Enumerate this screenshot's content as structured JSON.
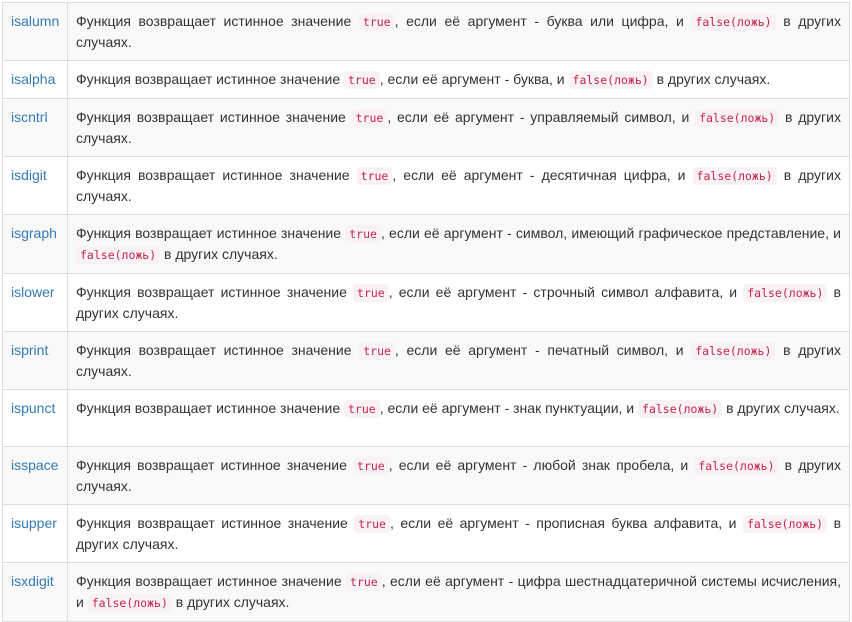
{
  "code": {
    "true_label": "true",
    "false_label": "false(ложь)"
  },
  "rows": [
    {
      "fn": "isalumn",
      "before": "Функция возвращает истинное значение ",
      "middle": ", если её аргумент - буква или цифра, и ",
      "after": " в других случаях."
    },
    {
      "fn": "isalpha",
      "before": "Функция возвращает истинное значение ",
      "middle": ", если её аргумент - буква,  и ",
      "after": " в других случаях."
    },
    {
      "fn": "iscntrl",
      "before": "Функция возвращает истинное значение ",
      "middle": ", если её аргумент - управляемый символ, и ",
      "after": " в других случаях."
    },
    {
      "fn": "isdigit",
      "before": "Функция возвращает истинное значение ",
      "middle": ", если её аргумент - десятичная цифра, и ",
      "after": " в других случаях."
    },
    {
      "fn": "isgraph",
      "before": "Функция возвращает истинное значение ",
      "middle": ", если её аргумент - символ, имеющий графическое представление, и ",
      "after": " в других случаях."
    },
    {
      "fn": "islower",
      "before": "Функция возвращает истинное значение ",
      "middle": ", если её аргумент - строчный символ алфавита, и ",
      "after": " в других случаях."
    },
    {
      "fn": "isprint",
      "before": "Функция возвращает истинное значение ",
      "middle": ", если её аргумент - печатный символ, и ",
      "after": " в других случаях."
    },
    {
      "fn": "ispunct",
      "before": "Функция возвращает истинное значение ",
      "middle": ", если её аргумент - знак пунктуации, и ",
      "after": " в других случаях."
    },
    {
      "fn": "isspace",
      "before": "Функция возвращает истинное значение ",
      "middle": ", если её аргумент - любой знак пробела, и ",
      "after": " в других случаях."
    },
    {
      "fn": "isupper",
      "before": "Функция возвращает истинное значение ",
      "middle": ", если её аргумент - прописная буква алфавита, и ",
      "after": " в других случаях."
    },
    {
      "fn": "isxdigit",
      "before": "Функция возвращает истинное значение ",
      "middle": ", если её аргумент - цифра шестнадцатеричной системы исчисления, и ",
      "after": " в других случаях."
    }
  ]
}
